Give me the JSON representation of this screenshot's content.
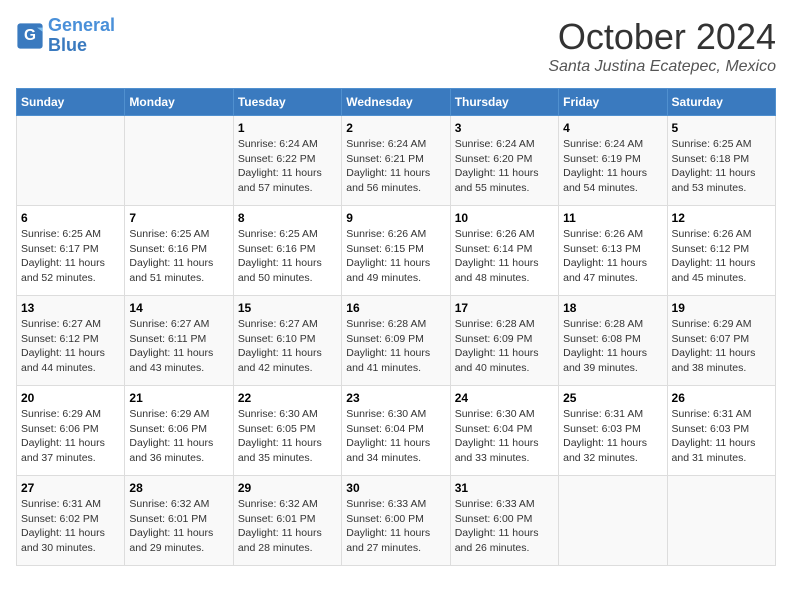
{
  "logo": {
    "line1": "General",
    "line2": "Blue"
  },
  "title": "October 2024",
  "location": "Santa Justina Ecatepec, Mexico",
  "days_of_week": [
    "Sunday",
    "Monday",
    "Tuesday",
    "Wednesday",
    "Thursday",
    "Friday",
    "Saturday"
  ],
  "weeks": [
    [
      {
        "day": "",
        "info": ""
      },
      {
        "day": "",
        "info": ""
      },
      {
        "day": "1",
        "info": "Sunrise: 6:24 AM\nSunset: 6:22 PM\nDaylight: 11 hours and 57 minutes."
      },
      {
        "day": "2",
        "info": "Sunrise: 6:24 AM\nSunset: 6:21 PM\nDaylight: 11 hours and 56 minutes."
      },
      {
        "day": "3",
        "info": "Sunrise: 6:24 AM\nSunset: 6:20 PM\nDaylight: 11 hours and 55 minutes."
      },
      {
        "day": "4",
        "info": "Sunrise: 6:24 AM\nSunset: 6:19 PM\nDaylight: 11 hours and 54 minutes."
      },
      {
        "day": "5",
        "info": "Sunrise: 6:25 AM\nSunset: 6:18 PM\nDaylight: 11 hours and 53 minutes."
      }
    ],
    [
      {
        "day": "6",
        "info": "Sunrise: 6:25 AM\nSunset: 6:17 PM\nDaylight: 11 hours and 52 minutes."
      },
      {
        "day": "7",
        "info": "Sunrise: 6:25 AM\nSunset: 6:16 PM\nDaylight: 11 hours and 51 minutes."
      },
      {
        "day": "8",
        "info": "Sunrise: 6:25 AM\nSunset: 6:16 PM\nDaylight: 11 hours and 50 minutes."
      },
      {
        "day": "9",
        "info": "Sunrise: 6:26 AM\nSunset: 6:15 PM\nDaylight: 11 hours and 49 minutes."
      },
      {
        "day": "10",
        "info": "Sunrise: 6:26 AM\nSunset: 6:14 PM\nDaylight: 11 hours and 48 minutes."
      },
      {
        "day": "11",
        "info": "Sunrise: 6:26 AM\nSunset: 6:13 PM\nDaylight: 11 hours and 47 minutes."
      },
      {
        "day": "12",
        "info": "Sunrise: 6:26 AM\nSunset: 6:12 PM\nDaylight: 11 hours and 45 minutes."
      }
    ],
    [
      {
        "day": "13",
        "info": "Sunrise: 6:27 AM\nSunset: 6:12 PM\nDaylight: 11 hours and 44 minutes."
      },
      {
        "day": "14",
        "info": "Sunrise: 6:27 AM\nSunset: 6:11 PM\nDaylight: 11 hours and 43 minutes."
      },
      {
        "day": "15",
        "info": "Sunrise: 6:27 AM\nSunset: 6:10 PM\nDaylight: 11 hours and 42 minutes."
      },
      {
        "day": "16",
        "info": "Sunrise: 6:28 AM\nSunset: 6:09 PM\nDaylight: 11 hours and 41 minutes."
      },
      {
        "day": "17",
        "info": "Sunrise: 6:28 AM\nSunset: 6:09 PM\nDaylight: 11 hours and 40 minutes."
      },
      {
        "day": "18",
        "info": "Sunrise: 6:28 AM\nSunset: 6:08 PM\nDaylight: 11 hours and 39 minutes."
      },
      {
        "day": "19",
        "info": "Sunrise: 6:29 AM\nSunset: 6:07 PM\nDaylight: 11 hours and 38 minutes."
      }
    ],
    [
      {
        "day": "20",
        "info": "Sunrise: 6:29 AM\nSunset: 6:06 PM\nDaylight: 11 hours and 37 minutes."
      },
      {
        "day": "21",
        "info": "Sunrise: 6:29 AM\nSunset: 6:06 PM\nDaylight: 11 hours and 36 minutes."
      },
      {
        "day": "22",
        "info": "Sunrise: 6:30 AM\nSunset: 6:05 PM\nDaylight: 11 hours and 35 minutes."
      },
      {
        "day": "23",
        "info": "Sunrise: 6:30 AM\nSunset: 6:04 PM\nDaylight: 11 hours and 34 minutes."
      },
      {
        "day": "24",
        "info": "Sunrise: 6:30 AM\nSunset: 6:04 PM\nDaylight: 11 hours and 33 minutes."
      },
      {
        "day": "25",
        "info": "Sunrise: 6:31 AM\nSunset: 6:03 PM\nDaylight: 11 hours and 32 minutes."
      },
      {
        "day": "26",
        "info": "Sunrise: 6:31 AM\nSunset: 6:03 PM\nDaylight: 11 hours and 31 minutes."
      }
    ],
    [
      {
        "day": "27",
        "info": "Sunrise: 6:31 AM\nSunset: 6:02 PM\nDaylight: 11 hours and 30 minutes."
      },
      {
        "day": "28",
        "info": "Sunrise: 6:32 AM\nSunset: 6:01 PM\nDaylight: 11 hours and 29 minutes."
      },
      {
        "day": "29",
        "info": "Sunrise: 6:32 AM\nSunset: 6:01 PM\nDaylight: 11 hours and 28 minutes."
      },
      {
        "day": "30",
        "info": "Sunrise: 6:33 AM\nSunset: 6:00 PM\nDaylight: 11 hours and 27 minutes."
      },
      {
        "day": "31",
        "info": "Sunrise: 6:33 AM\nSunset: 6:00 PM\nDaylight: 11 hours and 26 minutes."
      },
      {
        "day": "",
        "info": ""
      },
      {
        "day": "",
        "info": ""
      }
    ]
  ]
}
